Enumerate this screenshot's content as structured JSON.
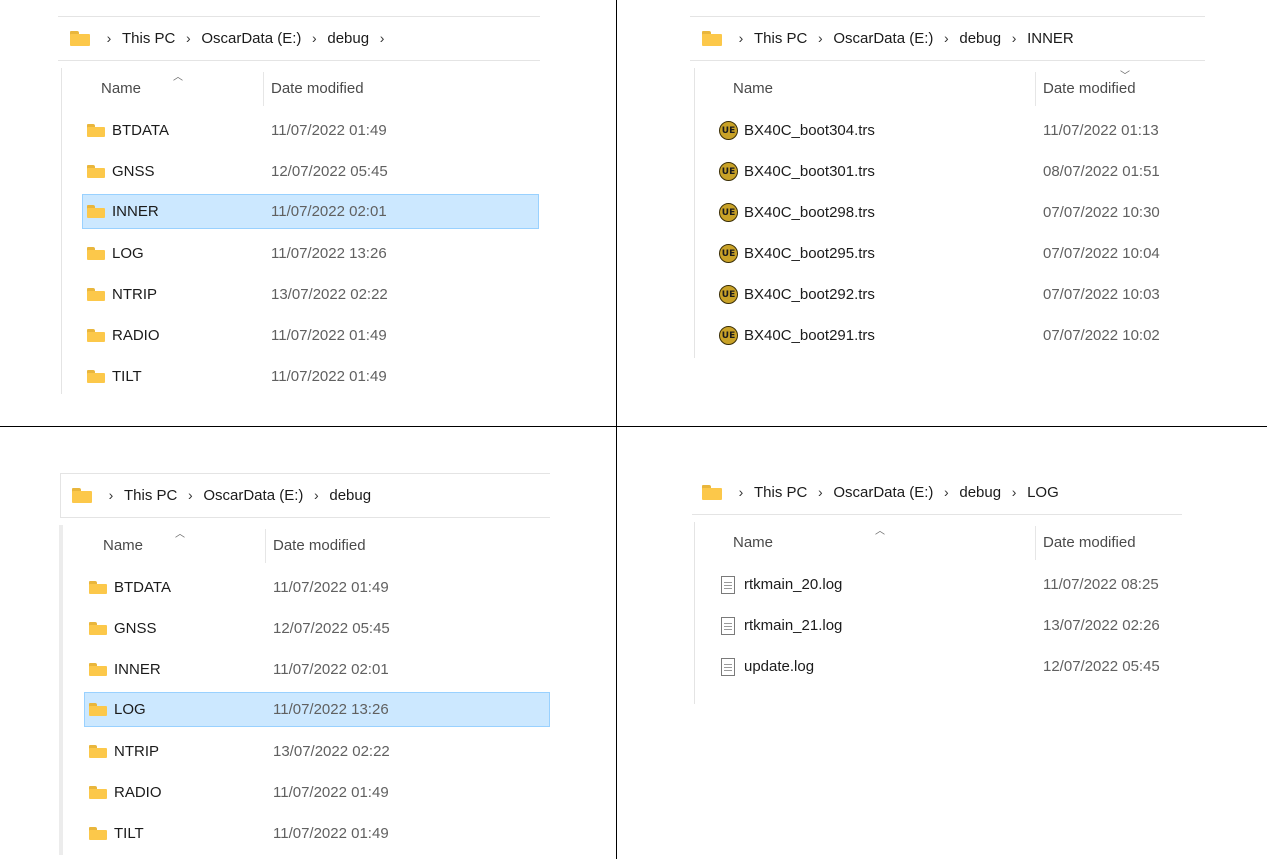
{
  "panel_tl": {
    "breadcrumb": [
      "This PC",
      "OscarData (E:)",
      "debug"
    ],
    "columns": {
      "name": "Name",
      "date": "Date modified"
    },
    "rows": [
      {
        "name": "BTDATA",
        "date": "11/07/2022 01:49"
      },
      {
        "name": "GNSS",
        "date": "12/07/2022 05:45"
      },
      {
        "name": "INNER",
        "date": "11/07/2022 02:01"
      },
      {
        "name": "LOG",
        "date": "11/07/2022 13:26"
      },
      {
        "name": "NTRIP",
        "date": "13/07/2022 02:22"
      },
      {
        "name": "RADIO",
        "date": "11/07/2022 01:49"
      },
      {
        "name": "TILT",
        "date": "11/07/2022 01:49"
      }
    ],
    "selected": "INNER"
  },
  "panel_tr": {
    "breadcrumb": [
      "This PC",
      "OscarData (E:)",
      "debug",
      "INNER"
    ],
    "columns": {
      "name": "Name",
      "date": "Date modified"
    },
    "rows": [
      {
        "name": "BX40C_boot304.trs",
        "date": "11/07/2022 01:13"
      },
      {
        "name": "BX40C_boot301.trs",
        "date": "08/07/2022 01:51"
      },
      {
        "name": "BX40C_boot298.trs",
        "date": "07/07/2022 10:30"
      },
      {
        "name": "BX40C_boot295.trs",
        "date": "07/07/2022 10:04"
      },
      {
        "name": "BX40C_boot292.trs",
        "date": "07/07/2022 10:03"
      },
      {
        "name": "BX40C_boot291.trs",
        "date": "07/07/2022 10:02"
      }
    ]
  },
  "panel_bl": {
    "breadcrumb": [
      "This PC",
      "OscarData (E:)",
      "debug"
    ],
    "columns": {
      "name": "Name",
      "date": "Date modified"
    },
    "rows": [
      {
        "name": "BTDATA",
        "date": "11/07/2022 01:49"
      },
      {
        "name": "GNSS",
        "date": "12/07/2022 05:45"
      },
      {
        "name": "INNER",
        "date": "11/07/2022 02:01"
      },
      {
        "name": "LOG",
        "date": "11/07/2022 13:26"
      },
      {
        "name": "NTRIP",
        "date": "13/07/2022 02:22"
      },
      {
        "name": "RADIO",
        "date": "11/07/2022 01:49"
      },
      {
        "name": "TILT",
        "date": "11/07/2022 01:49"
      }
    ],
    "selected": "LOG"
  },
  "panel_br": {
    "breadcrumb": [
      "This PC",
      "OscarData (E:)",
      "debug",
      "LOG"
    ],
    "columns": {
      "name": "Name",
      "date": "Date modified"
    },
    "rows": [
      {
        "name": "rtkmain_20.log",
        "date": "11/07/2022 08:25"
      },
      {
        "name": "rtkmain_21.log",
        "date": "13/07/2022 02:26"
      },
      {
        "name": "update.log",
        "date": "12/07/2022 05:45"
      }
    ]
  },
  "colors": {
    "folder": "#fcc84a",
    "selection_bg": "#cce8ff",
    "selection_border": "#99d1ff"
  },
  "icons": {
    "folder": "folder-icon",
    "trs_file": "ue-file-icon",
    "log_file": "text-file-icon",
    "chevron": "chevron-right-icon",
    "sort": "sort-ascending-icon"
  }
}
